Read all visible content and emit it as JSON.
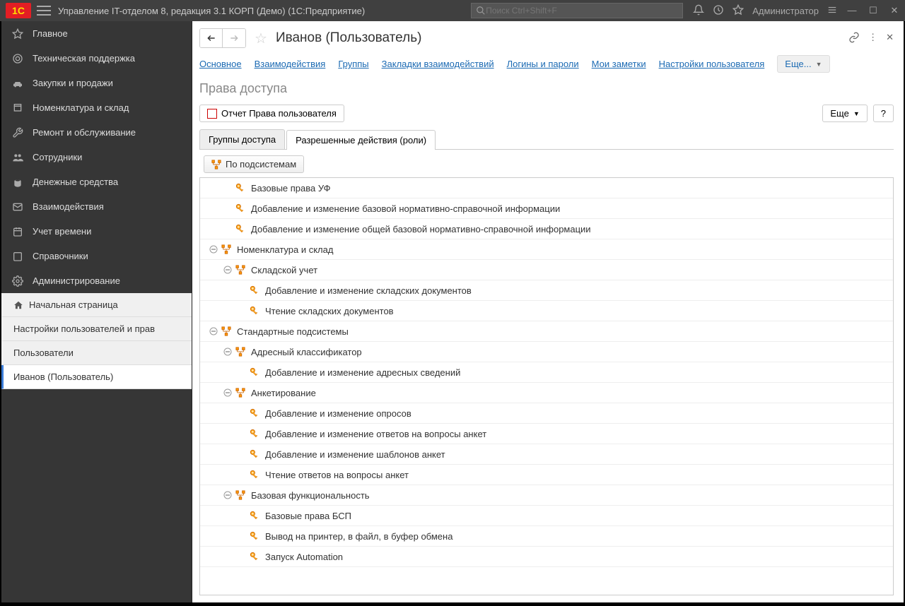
{
  "titlebar": {
    "title": "Управление IT-отделом 8, редакция 3.1 КОРП (Демо)  (1С:Предприятие)",
    "search_placeholder": "Поиск Ctrl+Shift+F",
    "user": "Администратор"
  },
  "sidebar": {
    "main_items": [
      "Главное",
      "Техническая поддержка",
      "Закупки и продажи",
      "Номенклатура и склад",
      "Ремонт и обслуживание",
      "Сотрудники",
      "Денежные средства",
      "Взаимодействия",
      "Учет времени",
      "Справочники",
      "Администрирование"
    ],
    "sub_items": [
      "Начальная страница",
      "Настройки пользователей и прав",
      "Пользователи",
      "Иванов (Пользователь)"
    ]
  },
  "main": {
    "page_title": "Иванов (Пользователь)",
    "links": [
      "Основное",
      "Взаимодействия",
      "Группы",
      "Закладки взаимодействий",
      "Логины и пароли",
      "Мои заметки",
      "Настройки пользователя"
    ],
    "more_label": "Еще...",
    "section_title": "Права доступа",
    "report_btn": "Отчет Права пользователя",
    "more_btn": "Еще",
    "help_btn": "?",
    "tabs": [
      "Группы доступа",
      "Разрешенные действия (роли)"
    ],
    "by_subsystems": "По подсистемам"
  },
  "tree": [
    {
      "level": 1,
      "type": "role",
      "label": "Базовые права УФ"
    },
    {
      "level": 1,
      "type": "role",
      "label": "Добавление и изменение базовой нормативно-справочной информации"
    },
    {
      "level": 1,
      "type": "role",
      "label": "Добавление и изменение общей базовой нормативно-справочной информации"
    },
    {
      "level": 0,
      "type": "folder",
      "label": "Номенклатура и склад",
      "expanded": true
    },
    {
      "level": 1,
      "type": "folder",
      "label": "Складской учет",
      "expanded": true
    },
    {
      "level": 2,
      "type": "role",
      "label": "Добавление и изменение складских документов"
    },
    {
      "level": 2,
      "type": "role",
      "label": "Чтение складских документов"
    },
    {
      "level": 0,
      "type": "folder",
      "label": "Стандартные подсистемы",
      "expanded": true
    },
    {
      "level": 1,
      "type": "folder",
      "label": "Адресный классификатор",
      "expanded": true
    },
    {
      "level": 2,
      "type": "role",
      "label": "Добавление и изменение адресных сведений"
    },
    {
      "level": 1,
      "type": "folder",
      "label": "Анкетирование",
      "expanded": true
    },
    {
      "level": 2,
      "type": "role",
      "label": "Добавление и изменение опросов"
    },
    {
      "level": 2,
      "type": "role",
      "label": "Добавление и изменение ответов на вопросы анкет"
    },
    {
      "level": 2,
      "type": "role",
      "label": "Добавление и изменение шаблонов анкет"
    },
    {
      "level": 2,
      "type": "role",
      "label": "Чтение ответов на вопросы анкет"
    },
    {
      "level": 1,
      "type": "folder",
      "label": "Базовая функциональность",
      "expanded": true
    },
    {
      "level": 2,
      "type": "role",
      "label": "Базовые права БСП"
    },
    {
      "level": 2,
      "type": "role",
      "label": "Вывод на принтер, в файл, в буфер обмена"
    },
    {
      "level": 2,
      "type": "role",
      "label": "Запуск Automation"
    }
  ]
}
